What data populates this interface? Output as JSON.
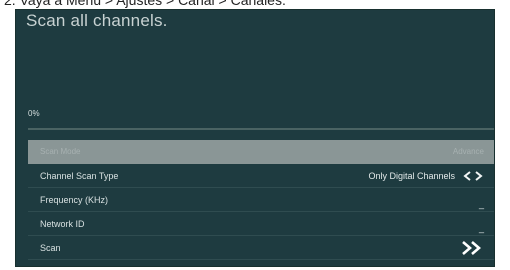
{
  "caption": "2.   Vaya a Menú > Ajustes > Canal > Canales.",
  "screen": {
    "title": "Scan all channels.",
    "progress": {
      "label": "0%",
      "value": 0
    }
  },
  "menu": {
    "items": [
      {
        "label": "Scan Mode",
        "value": "Advance"
      },
      {
        "label": "Channel Scan Type",
        "value": "Only Digital Channels",
        "icon": "left-right-arrows-icon"
      },
      {
        "label": "Frequency (KHz)",
        "value": "_"
      },
      {
        "label": "Network ID",
        "value": "_"
      },
      {
        "label": "Scan",
        "icon": "double-chevron-right-icon"
      }
    ]
  },
  "colors": {
    "screen_bg": "#1e3b40",
    "highlight_row": "#8a9696",
    "text": "#d8e1e1"
  }
}
